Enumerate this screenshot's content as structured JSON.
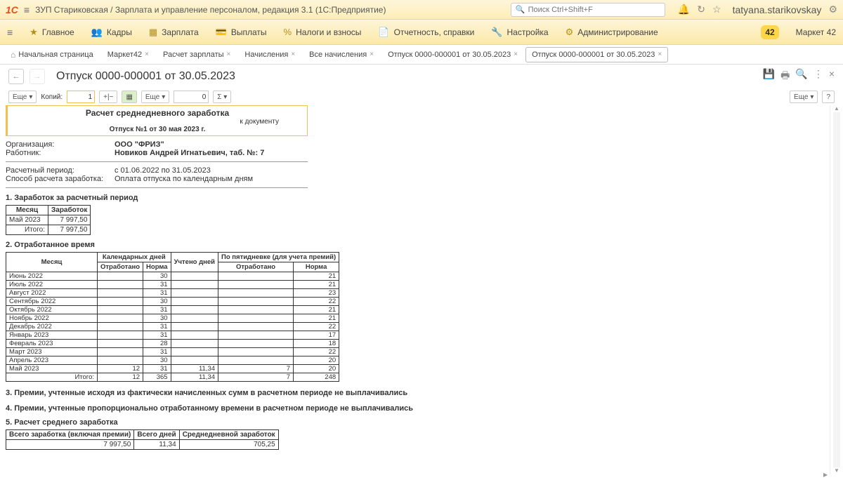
{
  "titlebar": {
    "app_title": "ЗУП Стариковская / Зарплата и управление персоналом, редакция 3.1  (1С:Предприятие)",
    "search_placeholder": "Поиск Ctrl+Shift+F",
    "user": "tatyana.starikovskay"
  },
  "mainnav": {
    "items": [
      "Главное",
      "Кадры",
      "Зарплата",
      "Выплаты",
      "Налоги и взносы",
      "Отчетность, справки",
      "Настройка",
      "Администрирование"
    ],
    "market_badge": "42",
    "market_label": "Маркет 42"
  },
  "tabs": {
    "home": "Начальная страница",
    "list": [
      "Маркет42",
      "Расчет зарплаты",
      "Начисления",
      "Все начисления",
      "Отпуск 0000-000001 от 30.05.2023"
    ],
    "active": "Отпуск 0000-000001 от 30.05.2023"
  },
  "page": {
    "title": "Отпуск 0000-000001 от 30.05.2023"
  },
  "subtool": {
    "more": "Еще",
    "copies": "Копий:",
    "copies_n": "1",
    "sum_n": "0",
    "help": "?"
  },
  "report": {
    "head_title": "Расчет среднедневного заработка",
    "head_sub": "к документу",
    "head_doc": "Отпуск №1 от 30 мая 2023 г.",
    "org_lbl": "Организация:",
    "org": "ООО \"ФРИЗ\"",
    "emp_lbl": "Работник:",
    "emp": "Новиков Андрей Игнатьевич, таб. №: 7",
    "period_lbl": "Расчетный период:",
    "period": "с 01.06.2022 по 31.05.2023",
    "method_lbl": "Способ расчета заработка:",
    "method": "Оплата отпуска по календарным дням",
    "sect1": "1. Заработок за расчетный период",
    "sect2": "2. Отработанное время",
    "sect3": "3. Премии, учтенные исходя из фактически начисленных сумм в расчетном периоде не выплачивались",
    "sect4": "4. Премии, учтенные пропорционально отработанному времени в расчетном периоде не выплачивались",
    "sect5": "5. Расчет среднего  заработка"
  },
  "earnings": {
    "h_month": "Месяц",
    "h_earn": "Заработок",
    "rows": [
      {
        "m": "Май 2023",
        "v": "7 997,50"
      }
    ],
    "total_lbl": "Итого:",
    "total": "7 997,50"
  },
  "time": {
    "h_month": "Месяц",
    "h_cal": "Календарных дней",
    "h_acc": "Учтено дней",
    "h_five": "По пятидневке (для учета премий)",
    "h_worked": "Отработано",
    "h_norm": "Норма",
    "rows": [
      {
        "m": "Июнь 2022",
        "w": "",
        "n": "30",
        "a": "",
        "fw": "",
        "fn": "21"
      },
      {
        "m": "Июль 2022",
        "w": "",
        "n": "31",
        "a": "",
        "fw": "",
        "fn": "21"
      },
      {
        "m": "Август 2022",
        "w": "",
        "n": "31",
        "a": "",
        "fw": "",
        "fn": "23"
      },
      {
        "m": "Сентябрь 2022",
        "w": "",
        "n": "30",
        "a": "",
        "fw": "",
        "fn": "22"
      },
      {
        "m": "Октябрь 2022",
        "w": "",
        "n": "31",
        "a": "",
        "fw": "",
        "fn": "21"
      },
      {
        "m": "Ноябрь 2022",
        "w": "",
        "n": "30",
        "a": "",
        "fw": "",
        "fn": "21"
      },
      {
        "m": "Декабрь 2022",
        "w": "",
        "n": "31",
        "a": "",
        "fw": "",
        "fn": "22"
      },
      {
        "m": "Январь 2023",
        "w": "",
        "n": "31",
        "a": "",
        "fw": "",
        "fn": "17"
      },
      {
        "m": "Февраль 2023",
        "w": "",
        "n": "28",
        "a": "",
        "fw": "",
        "fn": "18"
      },
      {
        "m": "Март 2023",
        "w": "",
        "n": "31",
        "a": "",
        "fw": "",
        "fn": "22"
      },
      {
        "m": "Апрель 2023",
        "w": "",
        "n": "30",
        "a": "",
        "fw": "",
        "fn": "20"
      },
      {
        "m": "Май 2023",
        "w": "12",
        "n": "31",
        "a": "11,34",
        "fw": "7",
        "fn": "20"
      }
    ],
    "total_lbl": "Итого:",
    "tw": "12",
    "tn": "365",
    "ta": "11,34",
    "tfw": "7",
    "tfn": "248"
  },
  "avg": {
    "h1": "Всего заработка (включая премии)",
    "h2": "Всего дней",
    "h3": "Среднедневной заработок",
    "v1": "7 997,50",
    "v2": "11,34",
    "v3": "705,25"
  }
}
